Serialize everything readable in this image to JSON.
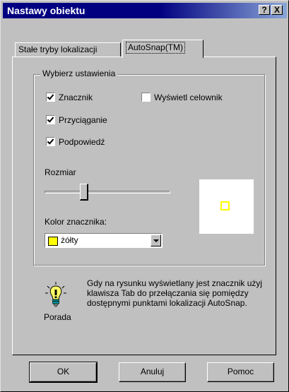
{
  "window": {
    "title": "Nastawy obiektu",
    "help_glyph": "?",
    "close_glyph": "X"
  },
  "tabs": [
    {
      "label": "Stałe tryby lokalizacji",
      "active": false
    },
    {
      "label": "AutoSnap(TM)",
      "active": true
    }
  ],
  "group": {
    "label": "Wybierz ustawienia"
  },
  "options": {
    "marker": {
      "label": "Znacznik",
      "checked": true
    },
    "magnet": {
      "label": "Przyciąganie",
      "checked": true
    },
    "tooltip": {
      "label": "Podpowiedź",
      "checked": true
    },
    "aperture": {
      "label": "Wyświetl celownik",
      "checked": false
    }
  },
  "size": {
    "label": "Rozmiar",
    "value": 0.3
  },
  "color": {
    "label": "Kolor znacznika:",
    "selected": "żółty",
    "swatch": "#ffff00"
  },
  "tip": {
    "text": "Gdy na rysunku wyświetlany jest znacznik użyj klawisza Tab do przełączania się pomiędzy dostępnymi punktami lokalizacji AutoSnap.",
    "label": "Porada",
    "icon": "lightbulb-icon"
  },
  "buttons": {
    "ok": "OK",
    "cancel": "Anuluj",
    "help": "Pomoc"
  }
}
